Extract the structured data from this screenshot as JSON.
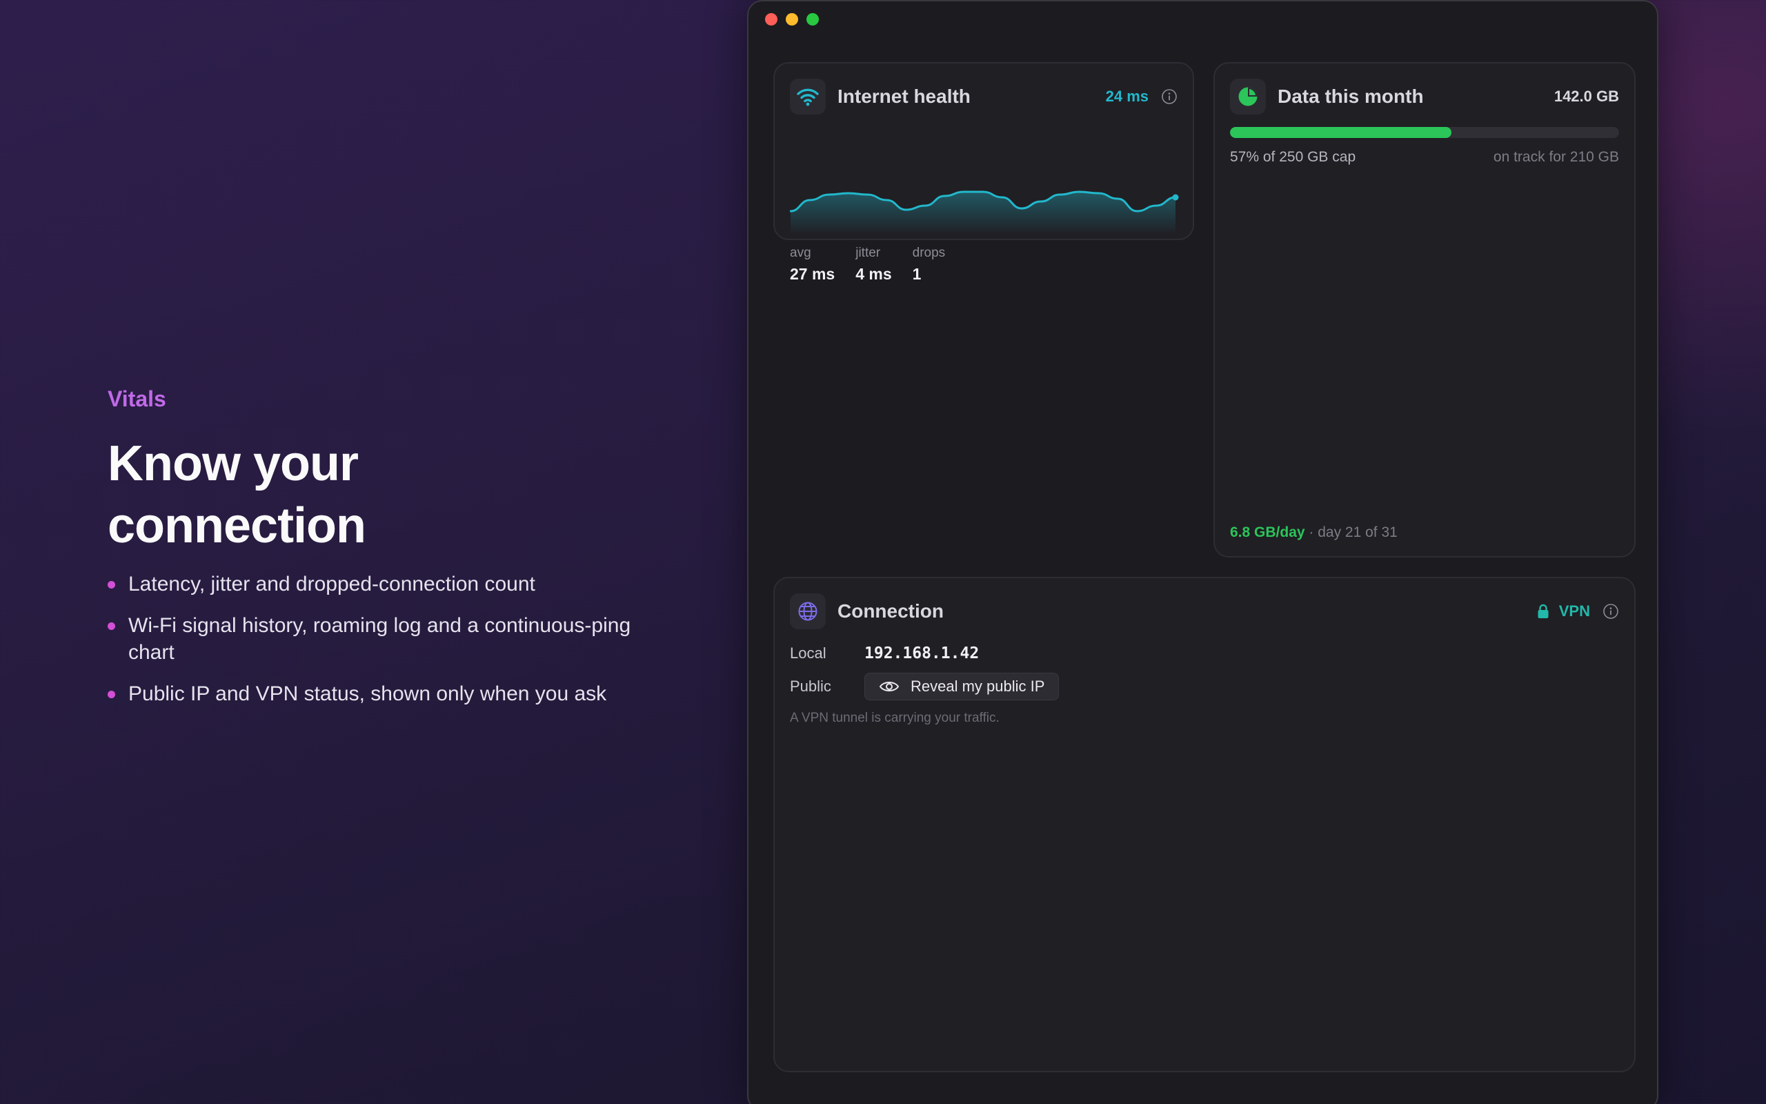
{
  "marketing": {
    "eyebrow": "Vitals",
    "headline_line1": "Know your",
    "headline_line2": "connection",
    "bullets": [
      "Latency, jitter and dropped-connection count",
      "Wi-Fi signal history, roaming log and a continuous-ping chart",
      "Public IP and VPN status, shown only when you ask"
    ]
  },
  "window": {
    "controls": [
      "close",
      "minimize",
      "zoom"
    ]
  },
  "internet_health": {
    "title": "Internet health",
    "icon": "wifi-icon",
    "current_latency": "24 ms",
    "stats": [
      {
        "label": "avg",
        "value": "27 ms"
      },
      {
        "label": "jitter",
        "value": "4 ms"
      },
      {
        "label": "drops",
        "value": "1"
      }
    ],
    "ping_series": [
      12,
      20,
      24,
      25,
      24,
      20,
      13,
      16,
      23,
      26,
      26,
      22,
      14,
      19,
      24,
      26,
      25,
      21,
      12,
      16,
      22
    ],
    "accent": "#22b8cc"
  },
  "data_usage": {
    "title": "Data this month",
    "icon": "pie-chart-icon",
    "total": "142.0 GB",
    "percent_of_cap": 57,
    "cap_text": "57% of 250 GB cap",
    "forecast": "on track for 210 GB",
    "daily_rate": "6.8 GB/day",
    "day_text": "· day 21 of 31",
    "accent": "#2bc55a"
  },
  "connection": {
    "title": "Connection",
    "icon": "globe-icon",
    "vpn_label": "VPN",
    "local_label": "Local",
    "local_ip": "192.168.1.42",
    "public_label": "Public",
    "reveal_button": "Reveal my public IP",
    "note": "A VPN tunnel is carrying your traffic.",
    "accent": "#22b8aa"
  }
}
